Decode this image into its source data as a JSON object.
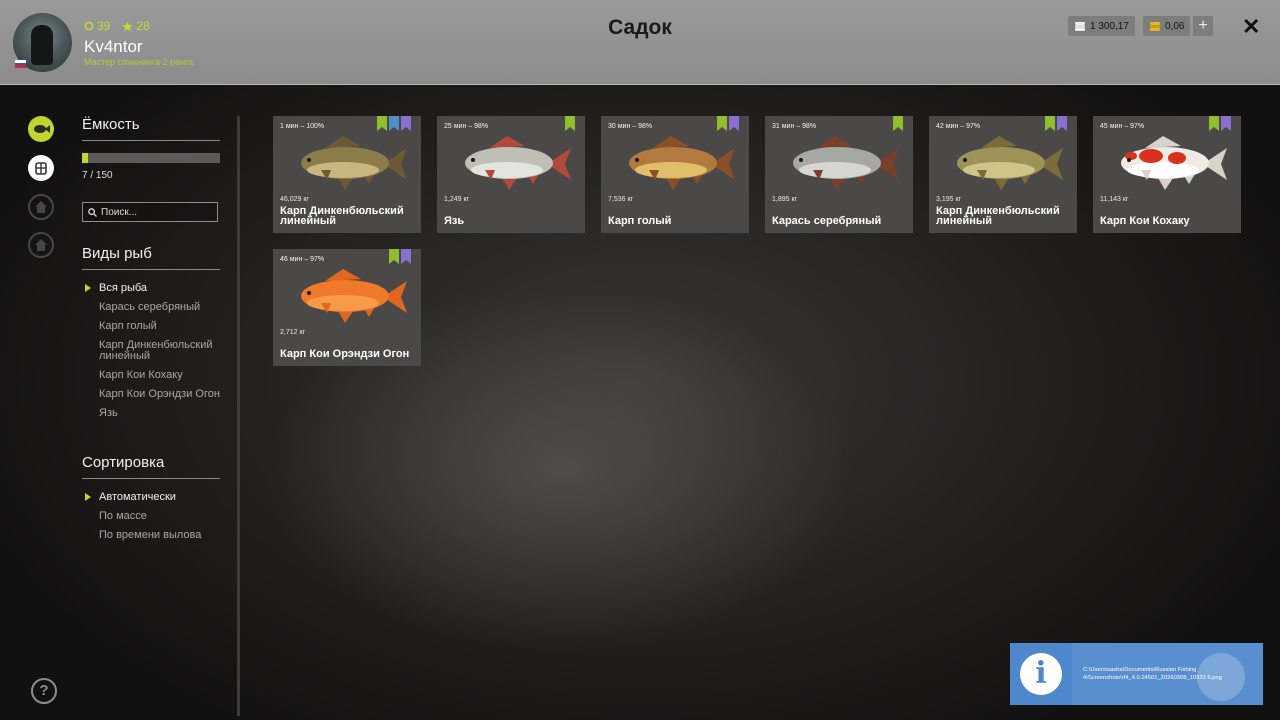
{
  "header": {
    "title": "Садок",
    "player": {
      "name": "Kv4ntor",
      "level": "39",
      "stars": "28",
      "rank": "Мастер спиннинга 2 ранга"
    },
    "silver": "1 300,17",
    "gold": "0,06",
    "add_label": "+",
    "close_label": "✕"
  },
  "sidebar": {
    "icons": [
      "fish-icon",
      "keepnet-icon",
      "home-icon",
      "home-icon"
    ],
    "capacity_title": "Ёмкость",
    "capacity_text": "7 / 150",
    "capacity_fraction": 0.047,
    "search_placeholder": "Поиск...",
    "species_title": "Виды рыб",
    "species": [
      "Вся рыба",
      "Карась серебряный",
      "Карп голый",
      "Карп Динкенбюльский линейный",
      "Карп Кои Кохаку",
      "Карп Кои Орэндзи Огон",
      "Язь"
    ],
    "sort_title": "Сортировка",
    "sort_options": [
      "Автоматически",
      "По массе",
      "По времени вылова"
    ],
    "help_label": "?"
  },
  "fish": [
    {
      "time": "1 мин – 100%",
      "weight": "46,029 кг",
      "name": "Карп Динкенбюльский линейный",
      "badges": [
        "green",
        "blue",
        "purple"
      ],
      "body": "#8b7c4a",
      "belly": "#c8b680",
      "fin": "#6b5a35"
    },
    {
      "time": "25 мин – 98%",
      "weight": "1,249 кг",
      "name": "Язь",
      "badges": [
        "green"
      ],
      "body": "#bfbfb8",
      "belly": "#e4e4de",
      "fin": "#b04a3a"
    },
    {
      "time": "30 мин – 98%",
      "weight": "7,536 кг",
      "name": "Карп голый",
      "badges": [
        "green",
        "purple"
      ],
      "body": "#b27a3e",
      "belly": "#e1bf6a",
      "fin": "#8a4f27"
    },
    {
      "time": "31 мин – 98%",
      "weight": "1,895 кг",
      "name": "Карась серебряный",
      "badges": [
        "green"
      ],
      "body": "#a7a7a3",
      "belly": "#d6d6d2",
      "fin": "#7a3f2a"
    },
    {
      "time": "42 мин – 97%",
      "weight": "3,195 кг",
      "name": "Карп Динкенбюльский линейный",
      "badges": [
        "green",
        "purple"
      ],
      "body": "#9d9257",
      "belly": "#cfc48a",
      "fin": "#7a6c3b"
    },
    {
      "time": "45 мин – 97%",
      "weight": "11,143 кг",
      "name": "Карп Кои Кохаку",
      "badges": [
        "green",
        "purple"
      ],
      "body": "#efeae3",
      "belly": "#ffffff",
      "fin": "#d9d2c8",
      "spot": "#d8321e"
    },
    {
      "time": "46 мин – 97%",
      "weight": "2,712 кг",
      "name": "Карп Кои Орэндзи Огон",
      "badges": [
        "green",
        "purple"
      ],
      "body": "#f07a2a",
      "belly": "#f79a4a",
      "fin": "#e0681e"
    }
  ],
  "notification": {
    "path": "C:\\Users\\sasha\\Documents\\Russian Fishing 4\\Screenshots\\rf4_4.0.24501_20260308_10333 6.png"
  }
}
